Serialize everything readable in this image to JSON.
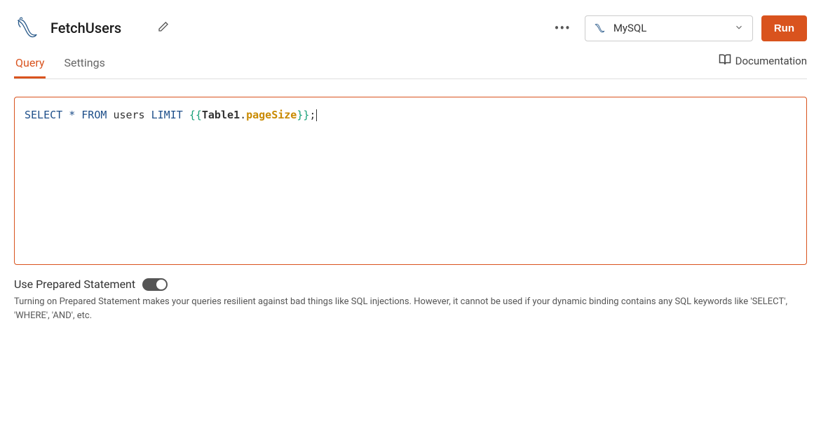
{
  "header": {
    "query_name": "FetchUsers",
    "datasource": {
      "label": "MySQL"
    },
    "run_label": "Run"
  },
  "tabs": {
    "query": "Query",
    "settings": "Settings"
  },
  "documentation_label": "Documentation",
  "code": {
    "select": "SELECT",
    "star": "*",
    "from": "FROM",
    "table": "users",
    "limit": "LIMIT",
    "open_brace": "{{",
    "bind_object": "Table1",
    "dot": ".",
    "bind_prop": "pageSize",
    "close_brace": "}}",
    "semi": ";"
  },
  "prepared": {
    "label": "Use Prepared Statement",
    "enabled": true,
    "description": "Turning on Prepared Statement makes your queries resilient against bad things like SQL injections. However, it cannot be used if your dynamic binding contains any SQL keywords like 'SELECT', 'WHERE', 'AND', etc."
  }
}
